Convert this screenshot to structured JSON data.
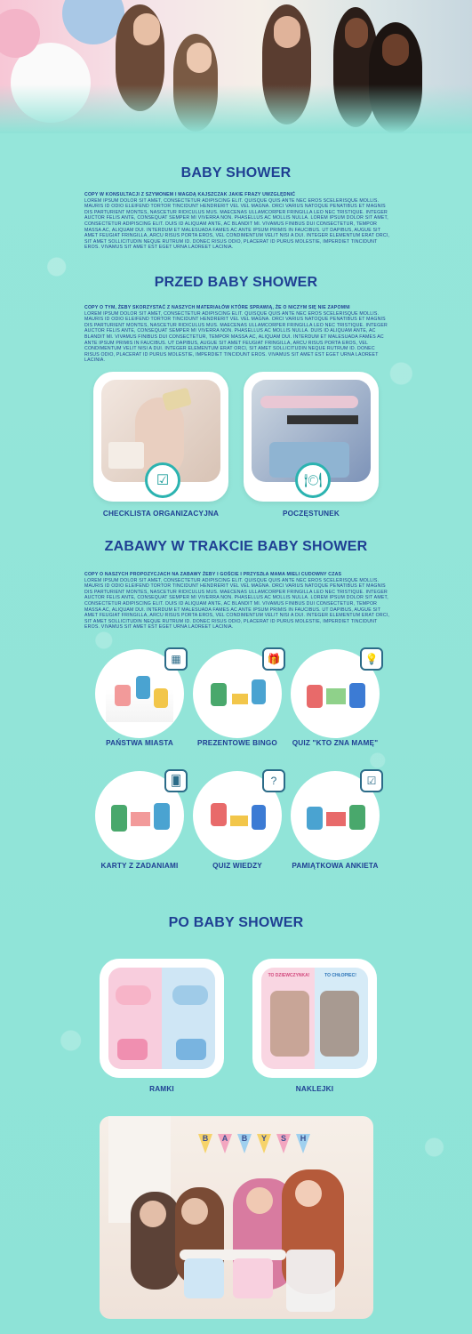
{
  "sections": {
    "baby_shower": {
      "title": "BABY SHOWER",
      "copy_lead": "COPY W KONSULTACJI Z SZYMONEM I MAGDĄ KAJSZCZAK JAKIE FRAZY UWZGLĘDNIĆ",
      "copy_body": "LOREM IPSUM DOLOR SIT AMET, CONSECTETUR ADIPISCING ELIT. QUISQUE QUIS ANTE NEC EROS SCELERISQUE MOLLIS. MAURIS ID ODIO ELEIFEND TORTOR TINCIDUNT HENDRERIT VEL VEL MAGNA. ORCI VARIUS NATOQUE PENATIBUS ET MAGNIS DIS PARTURIENT MONTES, NASCETUR RIDICULUS MUS. MAECENAS ULLAMCORPER FRINGILLA LEO NEC TRISTIQUE. INTEGER AUCTOR FELIS ANTE, CONSEQUAT SEMPER MI VIVERRA NON. PHASELLUS AC MOLLIS NULLA. LOREM IPSUM DOLOR SIT AMET, CONSECTETUR ADIPISCING ELIT. DUIS ID ALIQUAM ANTE, AC BLANDIT MI. VIVAMUS FINIBUS DUI CONSECTETUR, TEMPOR MASSA AC, ALIQUAM DUI. INTERDUM ET MALESUADA FAMES AC ANTE IPSUM PRIMIS IN FAUCIBUS. UT DAPIBUS, AUGUE SIT AMET FEUGIAT FRINGILLA, ARCU RISUS PORTA EROS, VEL CONDIMENTUM VELIT NISI A DUI. INTEGER ELEMENTUM ERAT ORCI, SIT AMET SOLLICITUDIN NEQUE RUTRUM ID. DONEC RISUS ODIO, PLACERAT ID PURUS MOLESTIE, IMPERDIET TINCIDUNT EROS. VIVAMUS SIT AMET EST EGET URNA LAOREET LACINIA."
    },
    "przed": {
      "title": "PRZED BABY SHOWER",
      "copy_lead": "COPY O TYM, ŻEBY SKORZYSTAĆ Z NASZYCH MATERIAŁÓW KTÓRE SPRAWIĄ, ŻE O NICZYM SIĘ NIE ZAPOMNI",
      "copy_body": "LOREM IPSUM DOLOR SIT AMET, CONSECTETUR ADIPISCING ELIT. QUISQUE QUIS ANTE NEC EROS SCELERISQUE MOLLIS. MAURIS ID ODIO ELEIFEND TORTOR TINCIDUNT HENDRERIT VEL VEL MAGNA. ORCI VARIUS NATOQUE PENATIBUS ET MAGNIS DIS PARTURIENT MONTES, NASCETUR RIDICULUS MUS. MAECENAS ULLAMCORPER FRINGILLA LEO NEC TRISTIQUE. INTEGER AUCTOR FELIS ANTE, CONSEQUAT SEMPER MI VIVERRA NON. PHASELLUS AC MOLLIS NULLA. DUIS ID ALIQUAM ANTE, AC BLANDIT MI. VIVAMUS FINIBUS DUI CONSECTETUR, TEMPOR MASSA AC, ALIQUAM DUI. INTERDUM ET MALESUADA FAMES AC ANTE IPSUM PRIMIS IN FAUCIBUS. UT DAPIBUS, AUGUE SIT AMET FEUGIAT FRINGILLA, ARCU RISUS PORTA EROS, VEL CONDIMENTUM VELIT NISI A DUI. INTEGER ELEMENTUM ERAT ORCI, SIT AMET SOLLICITUDIN NEQUE RUTRUM ID. DONEC RISUS ODIO, PLACERAT ID PURUS MOLESTIE, IMPERDIET TINCIDUNT EROS. VIVAMUS SIT AMET EST EGET URNA LAOREET LACINIA.",
      "cards": [
        {
          "label": "CHECKLISTA ORGANIZACYJNA",
          "icon": "checklist-icon"
        },
        {
          "label": "POCZĘSTUNEK",
          "icon": "plate-cutlery-icon"
        }
      ]
    },
    "zabawy": {
      "title": "ZABAWY W TRAKCIE BABY SHOWER",
      "copy_lead": "COPY O NASZYCH PROPOZYCJACH NA ZABAWY ŻEBY I GOŚCIE I PRZYSZŁA MAMA MIELI CUDOWNY CZAS",
      "copy_body": "LOREM IPSUM DOLOR SIT AMET, CONSECTETUR ADIPISCING ELIT. QUISQUE QUIS ANTE NEC EROS SCELERISQUE MOLLIS. MAURIS ID ODIO ELEIFEND TORTOR TINCIDUNT HENDRERIT VEL VEL MAGNA. ORCI VARIUS NATOQUE PENATIBUS ET MAGNIS DIS PARTURIENT MONTES, NASCETUR RIDICULUS MUS. MAECENAS ULLAMCORPER FRINGILLA LEO NEC TRISTIQUE. INTEGER AUCTOR FELIS ANTE, CONSEQUAT SEMPER MI VIVERRA NON. PHASELLUS AC MOLLIS NULLA. LOREM IPSUM DOLOR SIT AMET, CONSECTETUR ADIPISCING ELIT. DUIS ID ALIQUAM ANTE, AC BLANDIT MI. VIVAMUS FINIBUS DUI CONSECTETUR, TEMPOR MASSA AC, ALIQUAM DUI. INTERDUM ET MALESUADA FAMES AC ANTE IPSUM PRIMIS IN FAUCIBUS. UT DAPIBUS, AUGUE SIT AMET FEUGIAT FRINGILLA, ARCU RISUS PORTA EROS, VEL CONDIMENTUM VELIT NISI A DUI. INTEGER ELEMENTUM ERAT ORCI, SIT AMET SOLLICITUDIN NEQUE RUTRUM ID. DONEC RISUS ODIO, PLACERAT ID PURUS MOLESTIE, IMPERDIET TINCIDUNT EROS. VIVAMUS SIT AMET EST EGET URNA LAOREET LACINIA.",
      "games": [
        {
          "label": "PAŃSTWA MIASTA",
          "icon": "grid-icon"
        },
        {
          "label": "PREZENTOWE BINGO",
          "icon": "gift-icon"
        },
        {
          "label": "QUIZ \"KTO ZNA MAMĘ\"",
          "icon": "lightbulb-icon"
        },
        {
          "label": "KARTY Z ZADANIAMI",
          "icon": "cards-icon"
        },
        {
          "label": "QUIZ WIEDZY",
          "icon": "question-icon"
        },
        {
          "label": "PAMIĄTKOWA ANKIETA",
          "icon": "checklist-icon"
        }
      ]
    },
    "po": {
      "title": "PO BABY SHOWER",
      "tiles": [
        {
          "label": "RAMKI"
        },
        {
          "label": "NAKLEJKI",
          "badge_left": "TO DZIEWCZYNKA!",
          "badge_right": "TO CHŁOPIEC!"
        }
      ],
      "banner_letters": [
        "B",
        "A",
        "B",
        "Y",
        "S",
        "H"
      ]
    }
  },
  "colors": {
    "background": "#8ee3d7",
    "heading": "#1f3f93",
    "accent": "#2bb3b0"
  }
}
